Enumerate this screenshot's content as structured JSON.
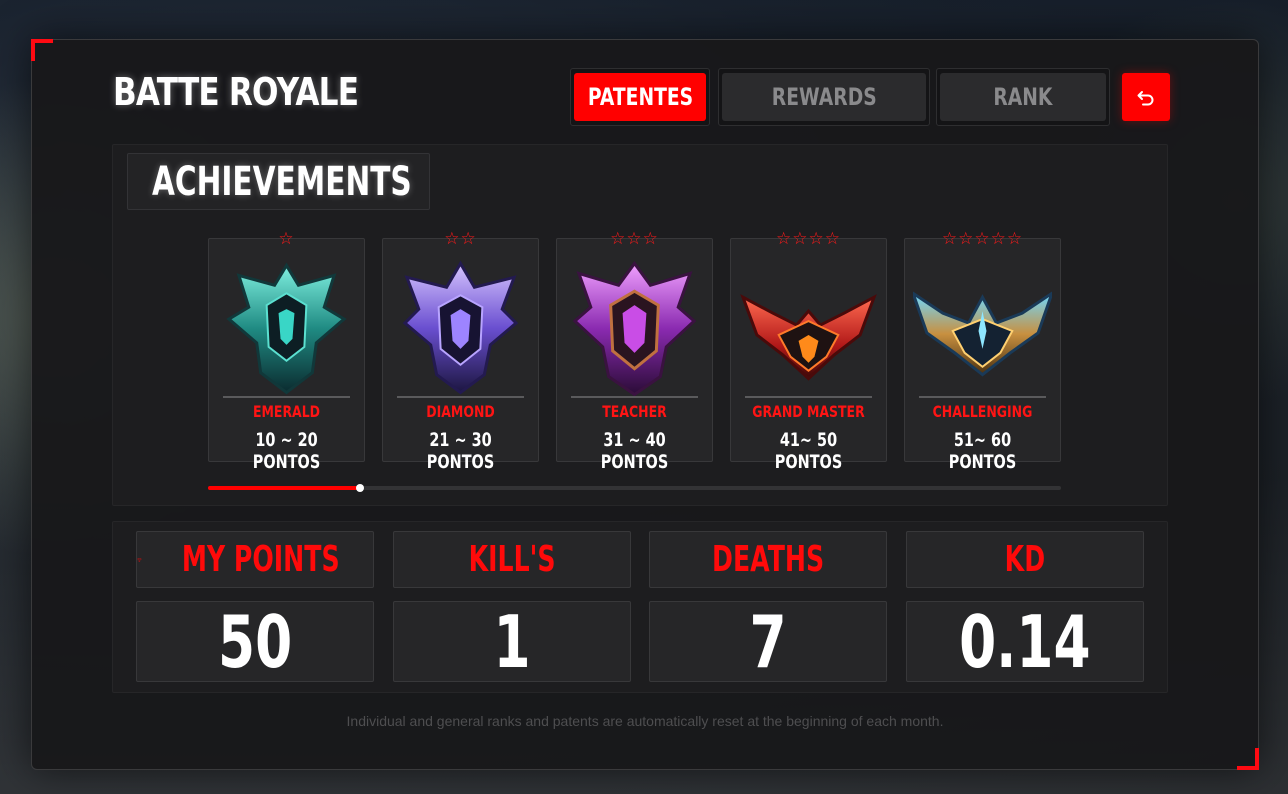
{
  "app": {
    "title": "BATTE ROYALE",
    "accent_color": "#ff0000"
  },
  "tabs": [
    {
      "label": "PATENTES",
      "active": true
    },
    {
      "label": "REWARDS",
      "active": false
    },
    {
      "label": "RANK",
      "active": false
    }
  ],
  "back_button": {
    "icon": "return-arrow-icon"
  },
  "achievements": {
    "title": "ACHIEVEMENTS",
    "icon": "medal-ribbon-icon",
    "ranks": [
      {
        "name": "EMERALD",
        "points": "10 ~ 20 PONTOS",
        "stars": 1,
        "emblem": "emerald-emblem-icon"
      },
      {
        "name": "DIAMOND",
        "points": "21 ~ 30 PONTOS",
        "stars": 2,
        "emblem": "diamond-emblem-icon"
      },
      {
        "name": "TEACHER",
        "points": "31 ~ 40 PONTOS",
        "stars": 3,
        "emblem": "teacher-emblem-icon"
      },
      {
        "name": "GRAND MASTER",
        "points": "41~ 50 PONTOS",
        "stars": 4,
        "emblem": "grand-master-emblem-icon"
      },
      {
        "name": "CHALLENGING",
        "points": "51~ 60 PONTOS",
        "stars": 5,
        "emblem": "challenging-emblem-icon"
      }
    ],
    "progress_fraction": 0.178
  },
  "stats": [
    {
      "label": "MY POINTS",
      "value": "50",
      "icon": "trophy-icon"
    },
    {
      "label": "KILL'S",
      "value": "1"
    },
    {
      "label": "DEATHS",
      "value": "7"
    },
    {
      "label": "KD",
      "value": "0.14"
    }
  ],
  "footer_note": "Individual and general ranks and patents are automatically reset at the beginning of each month."
}
